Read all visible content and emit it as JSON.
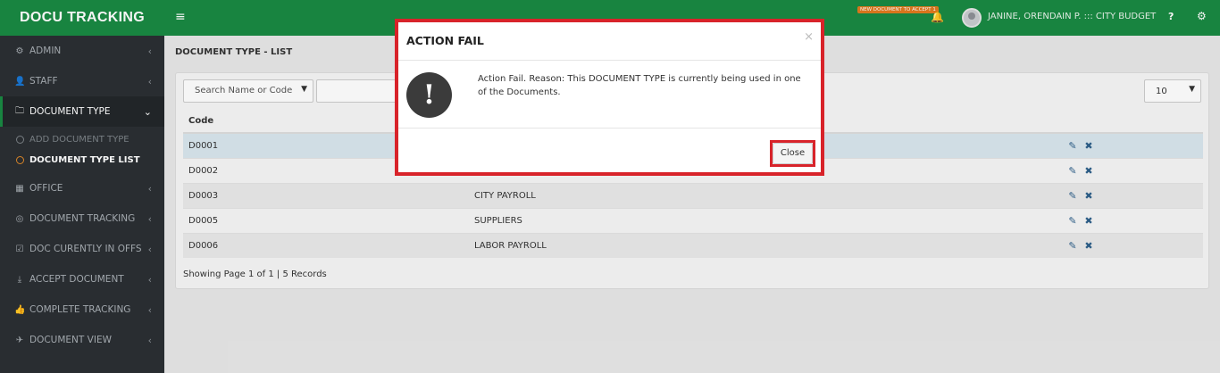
{
  "app": {
    "brand": "DOCU TRACKING",
    "hamburger_icon": "≡",
    "notification_badge": "NEW DOCUMENT TO ACCEPT 1",
    "bell_icon": "🔔",
    "user": "JANINE, ORENDAIN P. ::: CITY BUDGET",
    "help": "?",
    "settings_icon": "⚙",
    "brand_color": "#1a8a43"
  },
  "sidebar": {
    "items": [
      {
        "icon": "⚙",
        "icon_name": "gear-icon",
        "label": "ADMIN"
      },
      {
        "icon": "👤",
        "icon_name": "user-icon",
        "label": "STAFF"
      },
      {
        "icon": "🗀",
        "icon_name": "folder-icon",
        "label": "DOCUMENT TYPE"
      },
      {
        "icon": "▦",
        "icon_name": "building-icon",
        "label": "OFFICE"
      },
      {
        "icon": "◎",
        "icon_name": "target-icon",
        "label": "DOCUMENT TRACKING"
      },
      {
        "icon": "☑",
        "icon_name": "check-square-icon",
        "label": "DOC CURENTLY IN OFFS"
      },
      {
        "icon": "⤓",
        "icon_name": "download-icon",
        "label": "ACCEPT DOCUMENT"
      },
      {
        "icon": "👍",
        "icon_name": "thumbs-up-icon",
        "label": "COMPLETE TRACKING"
      },
      {
        "icon": "✈",
        "icon_name": "paper-plane-icon",
        "label": "DOCUMENT VIEW"
      }
    ],
    "sub_items": [
      {
        "label": "ADD DOCUMENT TYPE"
      },
      {
        "label": "DOCUMENT TYPE LIST"
      }
    ],
    "chevron_left": "‹",
    "chevron_down": "⌄"
  },
  "main": {
    "page_title": "DOCUMENT TYPE - LIST",
    "filter_select": "Search Name or Code",
    "page_size": "10",
    "dropdown_arrow": "▼",
    "columns": [
      "Code",
      "",
      ""
    ],
    "rows": [
      {
        "code": "D0001",
        "name": ""
      },
      {
        "code": "D0002",
        "name": ""
      },
      {
        "code": "D0003",
        "name": "CITY PAYROLL"
      },
      {
        "code": "D0005",
        "name": "SUPPLIERS"
      },
      {
        "code": "D0006",
        "name": "LABOR PAYROLL"
      }
    ],
    "edit_icon": "✎",
    "delete_icon": "✖",
    "footer": "Showing Page 1 of 1 | 5 Records"
  },
  "modal": {
    "title": "ACTION FAIL",
    "close_x": "×",
    "warning_icon": "!",
    "message": "Action Fail. Reason: This DOCUMENT TYPE is currently being used in one of the Documents.",
    "close_label": "Close",
    "highlight_color": "#d8232a"
  }
}
